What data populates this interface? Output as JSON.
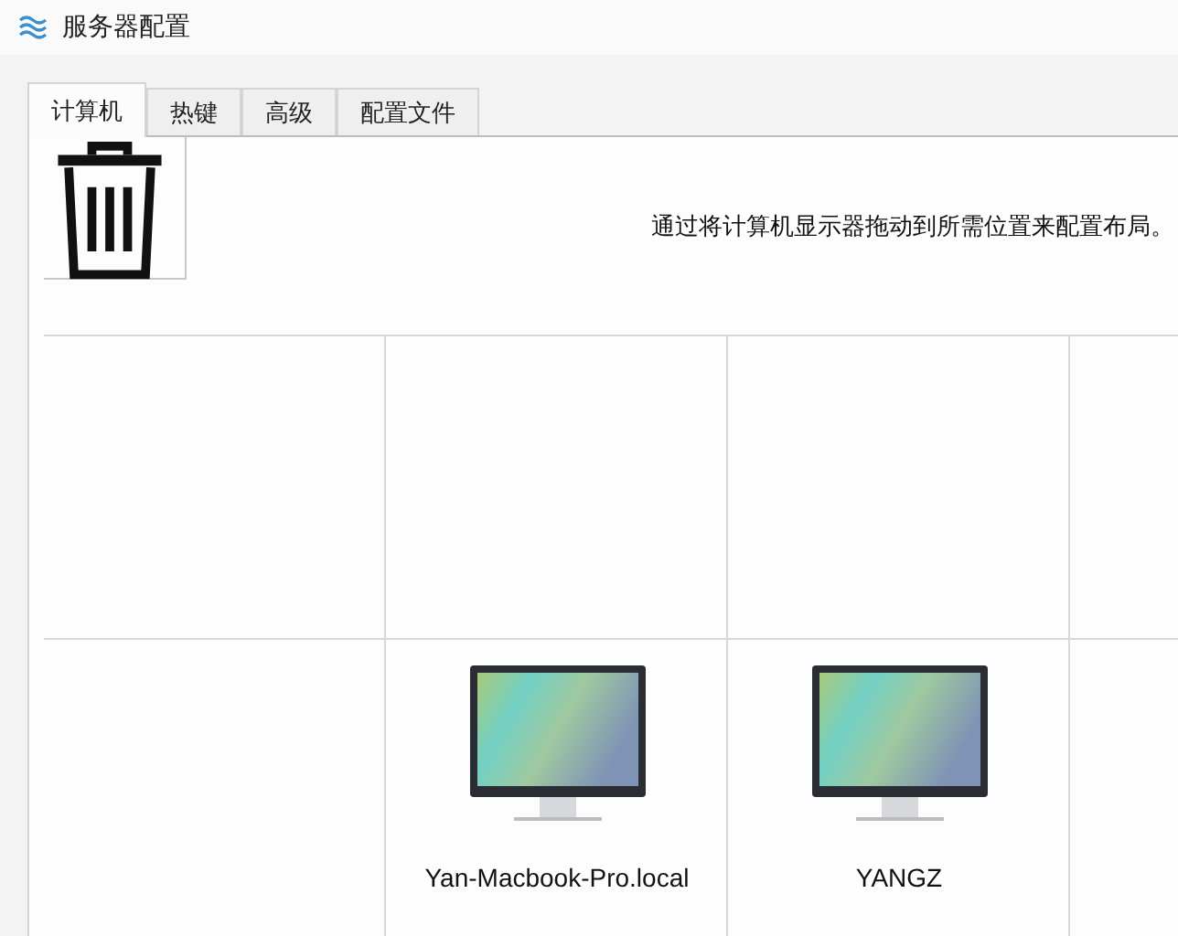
{
  "window": {
    "title": "服务器配置"
  },
  "tabs": [
    {
      "label": "计算机",
      "selected": true
    },
    {
      "label": "热键",
      "selected": false
    },
    {
      "label": "高级",
      "selected": false
    },
    {
      "label": "配置文件",
      "selected": false
    }
  ],
  "instruction": "通过将计算机显示器拖动到所需位置来配置布局。",
  "grid": {
    "rows": [
      [
        {
          "kind": "empty"
        },
        {
          "kind": "empty"
        },
        {
          "kind": "empty"
        },
        {
          "kind": "empty"
        }
      ],
      [
        {
          "kind": "empty"
        },
        {
          "kind": "computer",
          "name": "Yan-Macbook-Pro.local"
        },
        {
          "kind": "computer",
          "name": "YANGZ"
        },
        {
          "kind": "empty"
        }
      ]
    ]
  }
}
